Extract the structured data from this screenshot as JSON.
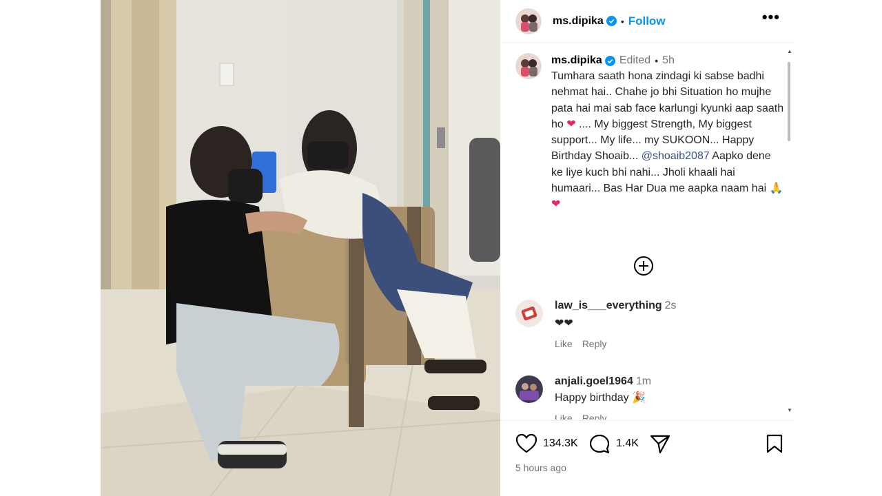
{
  "post": {
    "username": "ms.dipika",
    "follow_label": "Follow",
    "more_label": "•••",
    "caption_meta": {
      "edited": "Edited",
      "age": "5h"
    },
    "caption": {
      "part1": "Tumhara saath hona zindagi ki sabse badhi nehmat hai.. Chahe jo bhi Situation ho mujhe pata hai mai sab face karlungi kyunki aap saath ho ",
      "heart1": "❤",
      "part2": " .... My biggest Strength, My biggest support... My life... my SUKOON... Happy Birthday Shoaib... ",
      "mention": "@shoaib2087",
      "part3": " Aapko dene ke liye kuch bhi nahi... Jholi khaali hai humaari... Bas Har Dua me aapka naam hai ",
      "emoji_pray": "🙏",
      "heart2": "❤"
    },
    "comments": [
      {
        "username": "law_is___everything",
        "time": "2s",
        "text": "❤❤",
        "like": "Like",
        "reply": "Reply"
      },
      {
        "username": "anjali.goel1964",
        "time": "1m",
        "text": "Happy birthday 🎉",
        "like": "Like",
        "reply": "Reply"
      }
    ],
    "stats": {
      "likes": "134.3K",
      "comments": "1.4K"
    },
    "posted_ago": "5 hours ago"
  },
  "icons": {
    "heart": "heart-icon",
    "comment": "comment-icon",
    "share": "share-icon",
    "save": "bookmark-icon",
    "add": "plus-circle-icon",
    "verified": "verified-badge-icon"
  },
  "colors": {
    "follow": "#0095f6",
    "verified": "#0095f6",
    "heart_emoji": "#e8246b",
    "muted": "#737373"
  }
}
